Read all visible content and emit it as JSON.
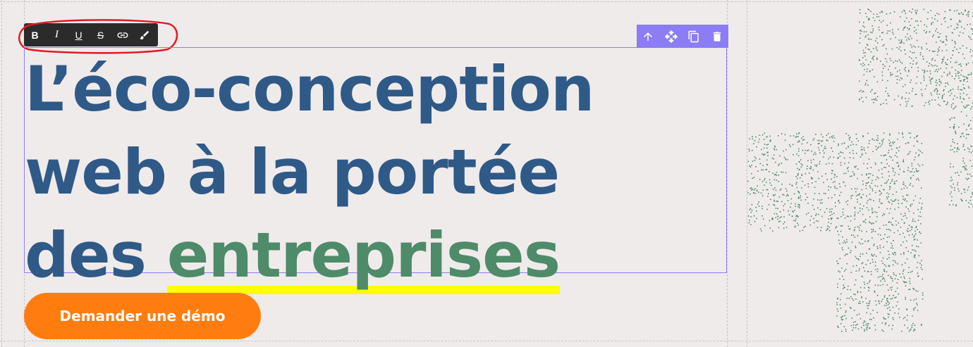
{
  "toolbar": {
    "items": [
      {
        "name": "bold",
        "label": "B"
      },
      {
        "name": "italic",
        "label": "I"
      },
      {
        "name": "underline",
        "label": "U"
      },
      {
        "name": "strike",
        "label": "S"
      },
      {
        "name": "link",
        "icon": "link-icon"
      },
      {
        "name": "style",
        "icon": "brush-icon"
      }
    ]
  },
  "block_actions": {
    "icons": [
      "arrow-up-icon",
      "move-icon",
      "copy-icon",
      "trash-icon"
    ]
  },
  "heading": {
    "line1": "L’éco-conception",
    "line2": "web à la portée",
    "line3_prefix": "des ",
    "line3_highlight": "entreprises"
  },
  "cta": {
    "label": "Demander une démo"
  },
  "colors": {
    "heading": "#2f5a87",
    "highlight_text": "#4e8b69",
    "highlight_marker": "#ffff00",
    "cta": "#ff7d0f",
    "selection": "#8c7cf5",
    "pattern": "#4e8b69",
    "annotation": "#e01b24"
  }
}
